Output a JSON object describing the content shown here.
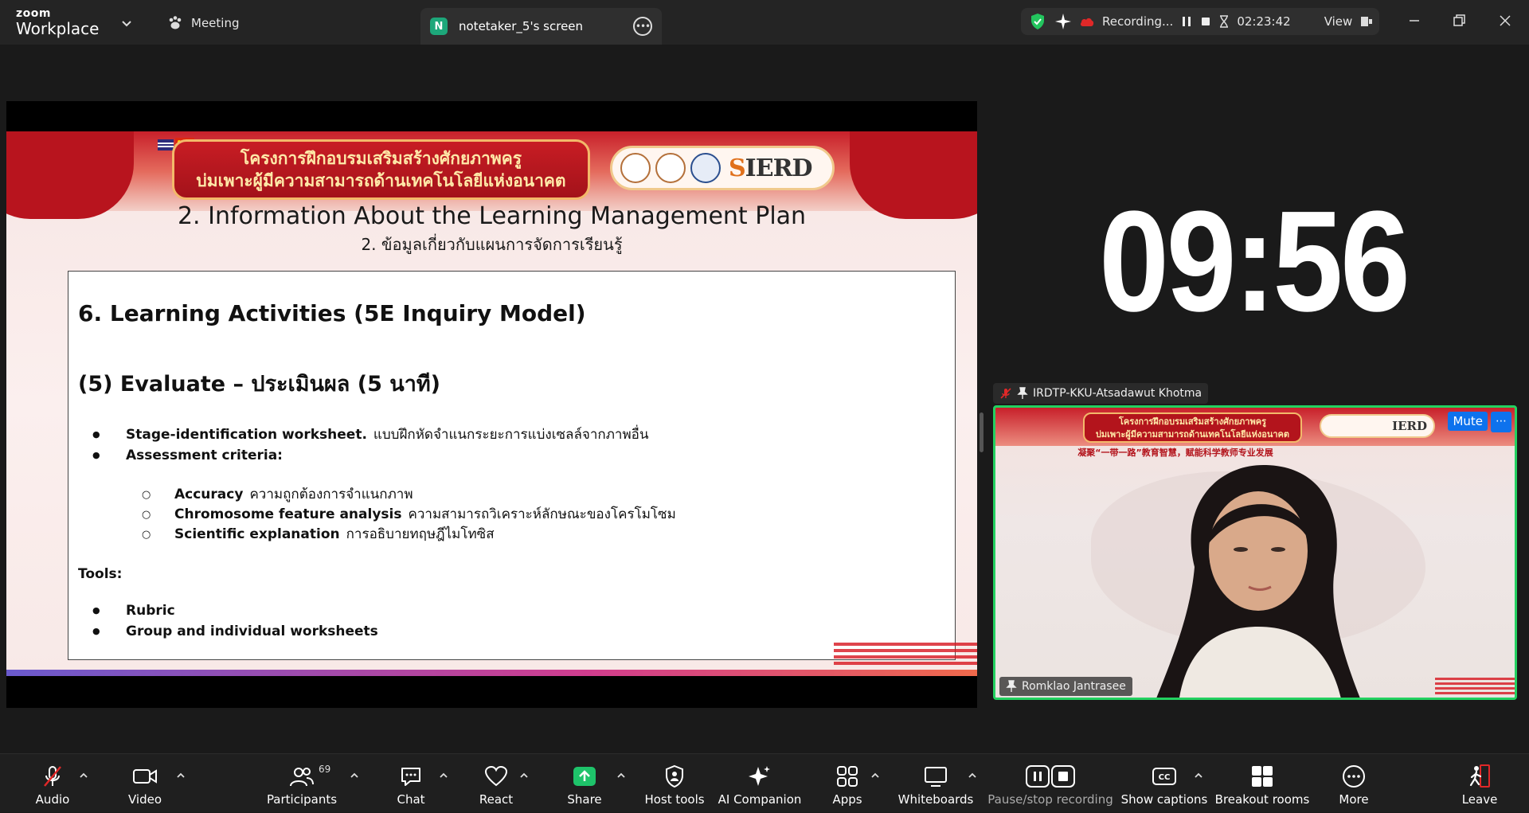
{
  "app": {
    "brand_top": "zoom",
    "brand_bottom": "Workplace"
  },
  "tabs": {
    "meeting": "Meeting",
    "screen_avatar": "N",
    "screen": "notetaker_5's screen"
  },
  "recording": {
    "label": "Recording...",
    "elapsed": "02:23:42",
    "view": "View"
  },
  "slide": {
    "banner_line1": "โครงการฝึกอบรมเสริมสร้างศักยภาพครู",
    "banner_line2": "บ่มเพาะผู้มีความสามารถด้านเทคโนโลยีแห่งอนาคต",
    "logo_text_s": "S",
    "logo_text": "IERD",
    "heading_en": "2. Information About the Learning Management Plan",
    "heading_th": "2. ข้อมูลเกี่ยวกับแผนการจัดการเรียนรู้",
    "card_title": "6. Learning Activities (5E Inquiry Model)",
    "card_subtitle": "(5) Evaluate – ประเมินผล (5 นาที)",
    "bullets": [
      {
        "bold": "Stage-identification worksheet.",
        "text": "แบบฝึกหัดจำแนกระยะการแบ่งเซลล์จากภาพอื่น"
      },
      {
        "bold": "Assessment criteria:",
        "text": ""
      }
    ],
    "criteria": [
      {
        "bold": "Accuracy",
        "text": "ความถูกต้องการจำแนกภาพ"
      },
      {
        "bold": "Chromosome feature analysis",
        "text": "ความสามารถวิเคราะห์ลักษณะของโครโมโซม"
      },
      {
        "bold": "Scientific explanation",
        "text": "การอธิบายทฤษฎีไมโทซิส"
      }
    ],
    "tools_label": "Tools:",
    "tools": [
      {
        "bold": "Rubric",
        "text": ""
      },
      {
        "bold": "Group and individual worksheets",
        "text": ""
      }
    ]
  },
  "timer": "09:56",
  "participant_pinned": "IRDTP-KKU-Atsadawut Khotma",
  "video": {
    "banner_line1": "โครงการฝึกอบรมเสริมสร้างศักยภาพครู",
    "banner_line2": "บ่มเพาะผู้มีความสามารถด้านเทคโนโลยีแห่งอนาคต",
    "logo_text": "IERD",
    "cn_text": "凝聚“一带一路”教育智慧，赋能科学教师专业发展",
    "mute": "Mute",
    "name": "Romklao Jantrasee"
  },
  "toolbar": {
    "audio": "Audio",
    "video": "Video",
    "participants": "Participants",
    "participants_count": "69",
    "chat": "Chat",
    "react": "React",
    "share": "Share",
    "host_tools": "Host tools",
    "ai_companion": "AI Companion",
    "apps": "Apps",
    "whiteboards": "Whiteboards",
    "pause_stop": "Pause/stop recording",
    "captions": "Show captions",
    "breakout": "Breakout rooms",
    "more": "More",
    "leave": "Leave"
  },
  "colors": {
    "accent": "#0e72ed",
    "share_green": "#1ec36a",
    "active_speaker": "#23d160",
    "leave_red": "#e02828"
  }
}
